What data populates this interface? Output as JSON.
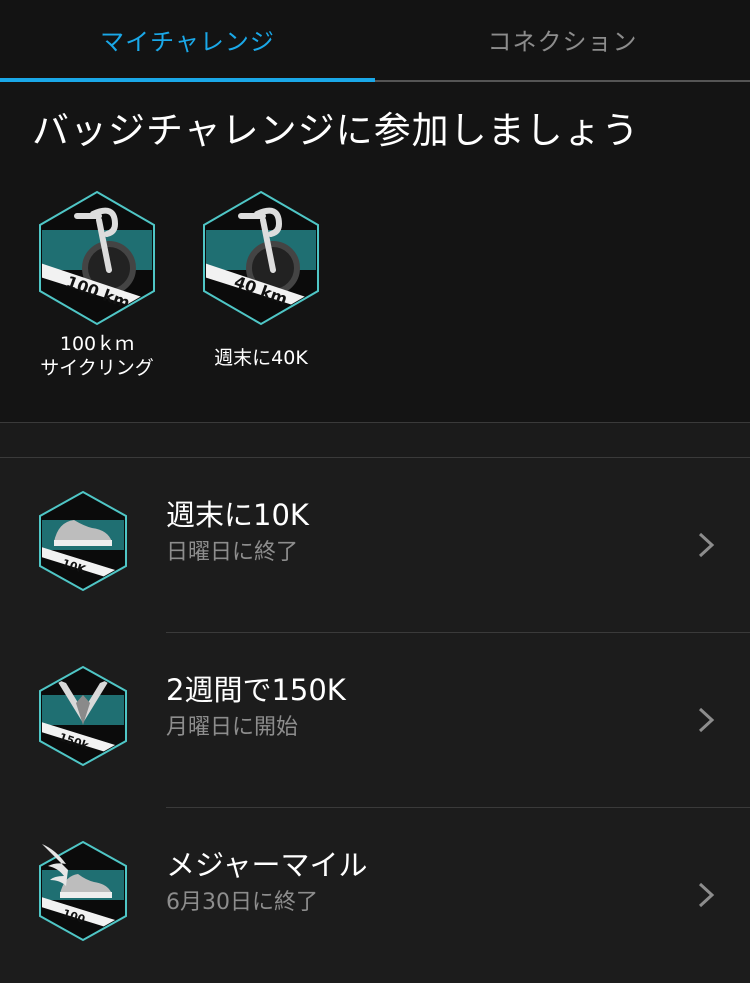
{
  "tabs": [
    {
      "label": "マイチャレンジ",
      "active": true
    },
    {
      "label": "コネクション",
      "active": false
    }
  ],
  "colors": {
    "accent": "#1aa8e8",
    "badge_teal": "#1f6f72",
    "badge_border": "#4fc6c6"
  },
  "heading": "バッジチャレンジに参加しましょう",
  "badges": [
    {
      "icon": "cycling-100km-badge-icon",
      "badge_text": "100 km",
      "label_line1": "100ｋｍ",
      "label_line2": "サイクリング"
    },
    {
      "icon": "cycling-40km-badge-icon",
      "badge_text": "40 km",
      "label_line1": "週末に40K"
    }
  ],
  "challenges": [
    {
      "icon": "running-10k-badge-icon",
      "badge_text": "10K",
      "title": "週末に10K",
      "subtitle": "日曜日に終了"
    },
    {
      "icon": "wings-150k-badge-icon",
      "badge_text": "150k",
      "title": "2週間で150K",
      "subtitle": "月曜日に開始"
    },
    {
      "icon": "winged-shoe-100-badge-icon",
      "badge_text": "100",
      "title": "メジャーマイル",
      "subtitle": "6月30日に終了"
    }
  ]
}
